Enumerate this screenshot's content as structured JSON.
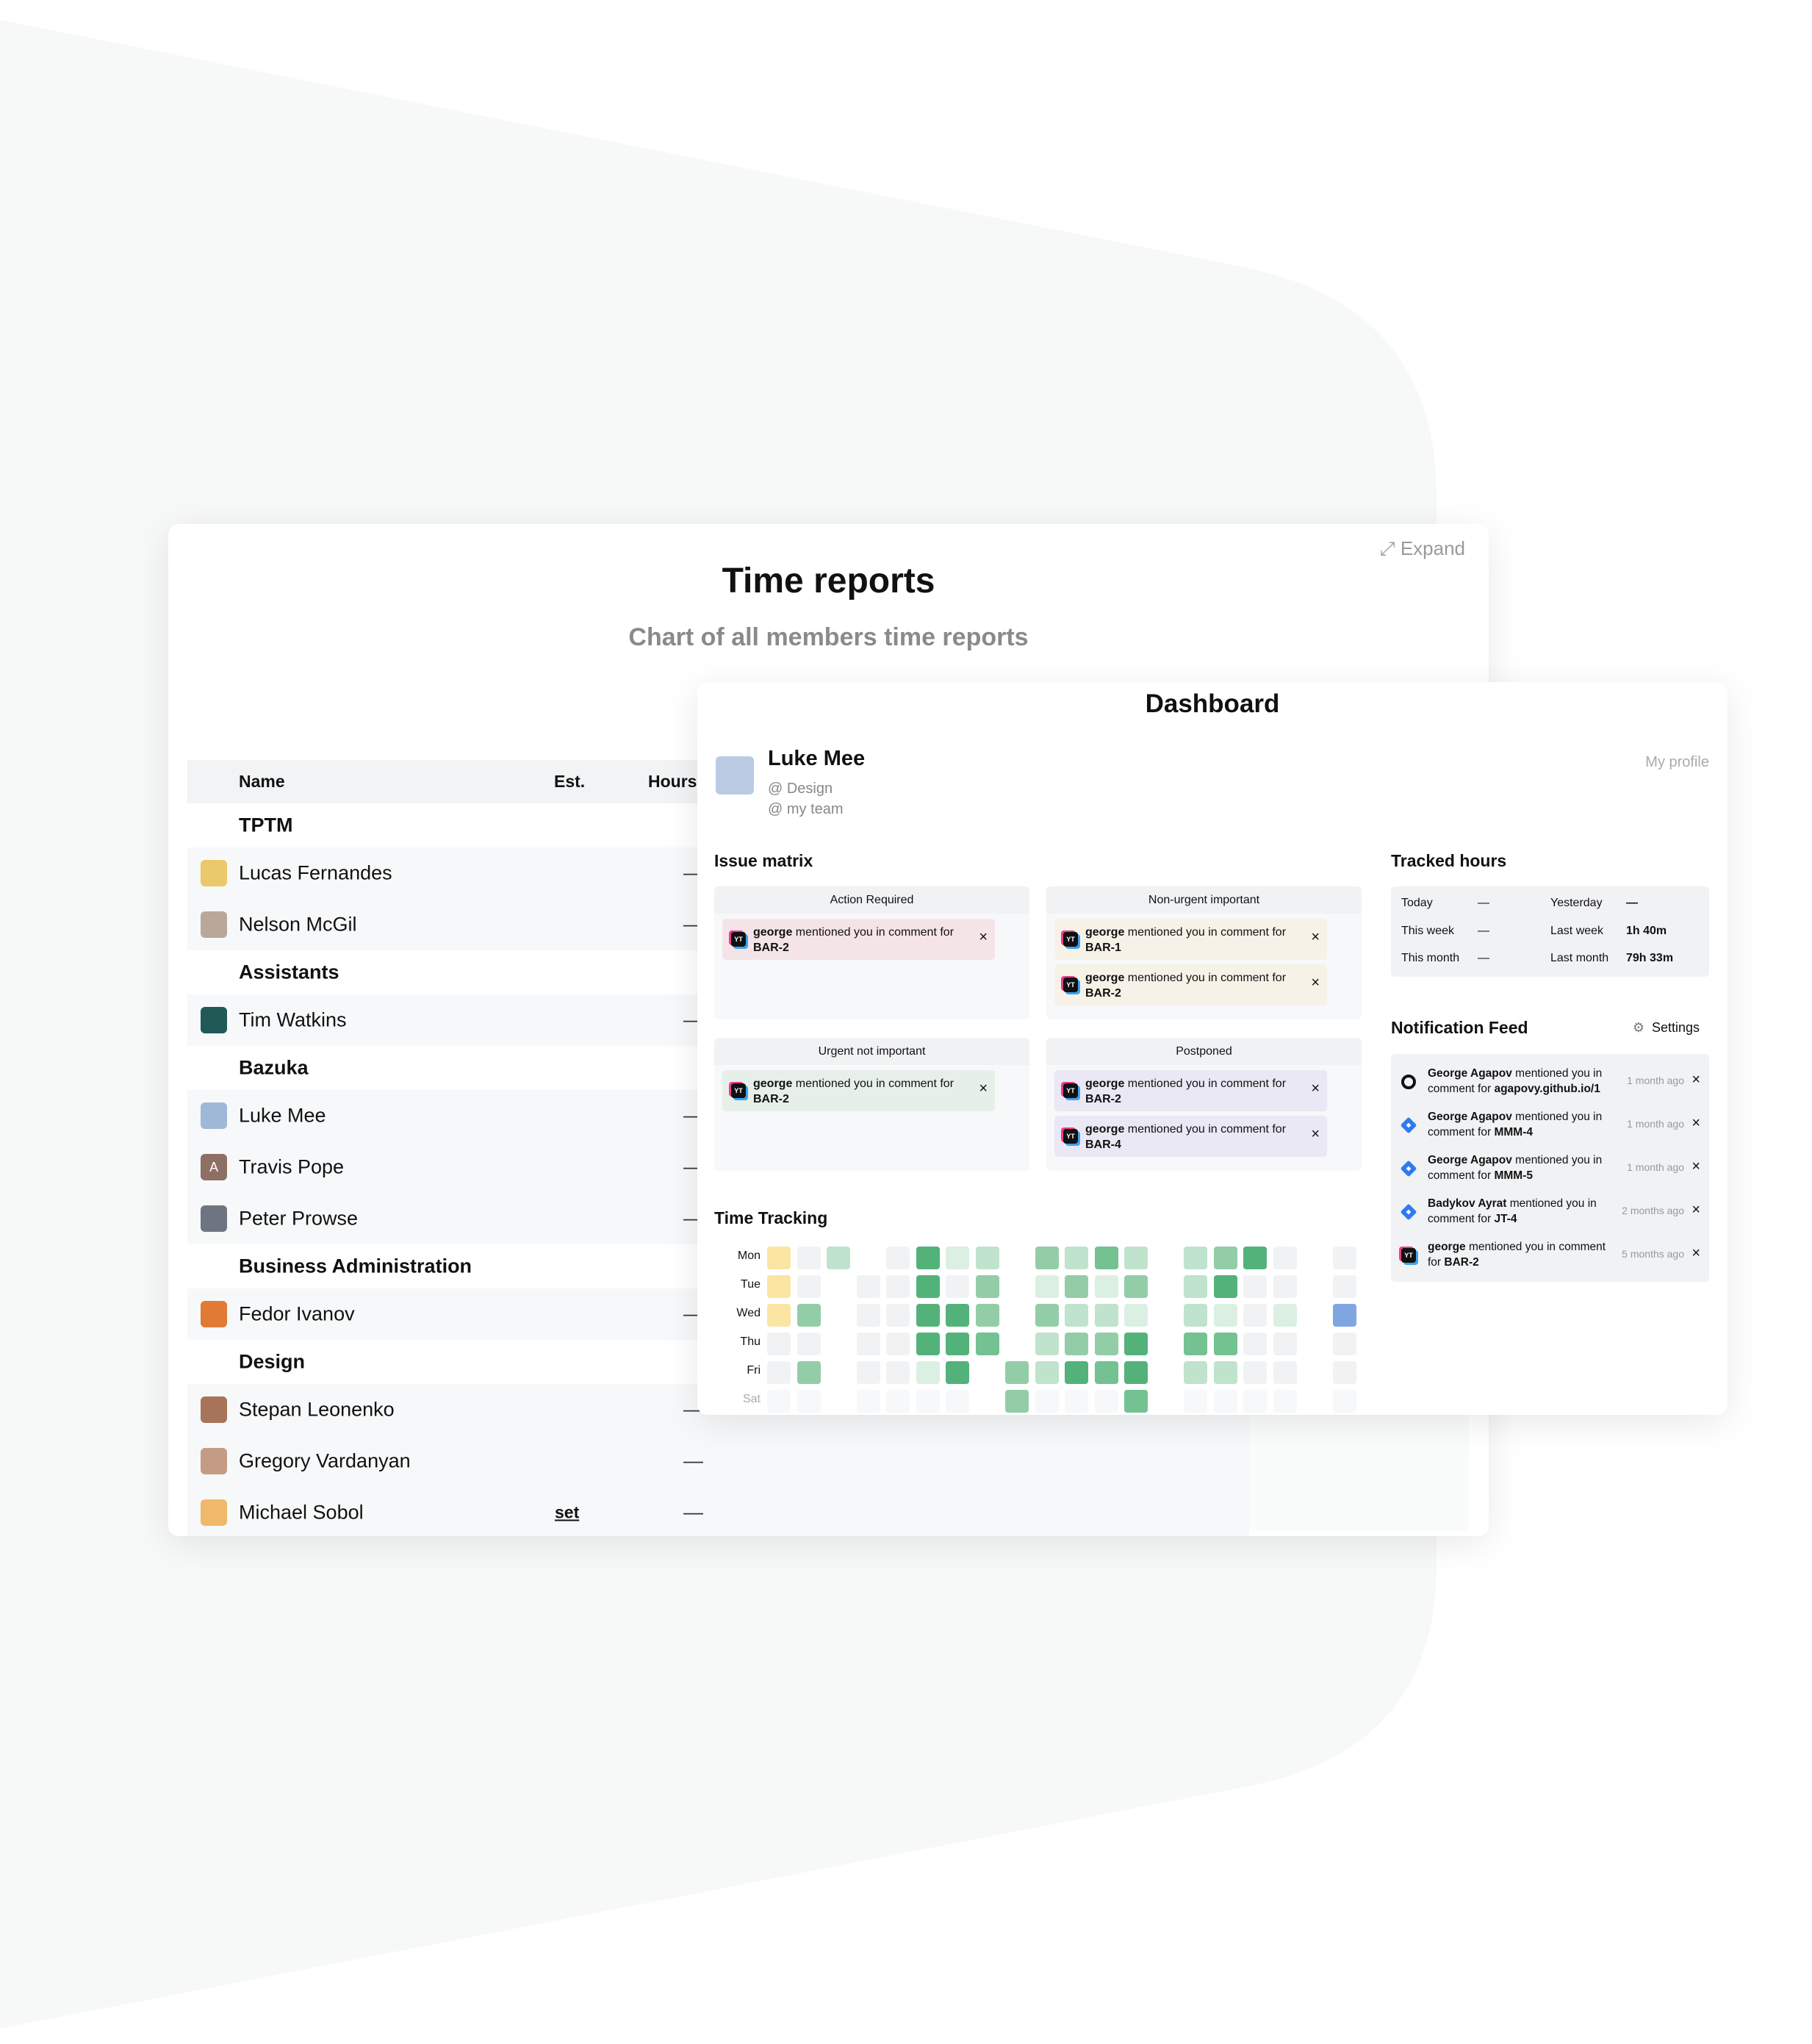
{
  "time_reports": {
    "title": "Time reports",
    "subtitle": "Chart of all members time reports",
    "expand_label": "Expand",
    "columns": {
      "name": "Name",
      "est": "Est.",
      "hours": "Hours"
    },
    "rows": [
      {
        "type": "group",
        "name": "TPTM"
      },
      {
        "type": "member",
        "name": "Lucas Fernandes",
        "hours": "—",
        "avatar_color": "#e9c96a"
      },
      {
        "type": "member",
        "name": "Nelson McGil",
        "hours": "—",
        "avatar_color": "#b9a89a"
      },
      {
        "type": "group",
        "name": "Assistants"
      },
      {
        "type": "member",
        "name": "Tim Watkins",
        "hours": "—",
        "avatar_color": "#1f5a57"
      },
      {
        "type": "group",
        "name": "Bazuka"
      },
      {
        "type": "member",
        "name": "Luke Mee",
        "hours": "—",
        "avatar_color": "#9fb8d8"
      },
      {
        "type": "member",
        "name": "Travis Pope",
        "hours": "—",
        "avatar_color": "#8e6f64",
        "initial": "A"
      },
      {
        "type": "member",
        "name": "Peter Prowse",
        "hours": "—",
        "avatar_color": "#6d7680"
      },
      {
        "type": "group",
        "name": "Business Administration"
      },
      {
        "type": "member",
        "name": "Fedor Ivanov",
        "hours": "—",
        "avatar_color": "#e07a34"
      },
      {
        "type": "group",
        "name": "Design"
      },
      {
        "type": "member",
        "name": "Stepan Leonenko",
        "hours": "—",
        "avatar_color": "#a7745a"
      },
      {
        "type": "member",
        "name": "Gregory Vardanyan",
        "hours": "—",
        "avatar_color": "#c49b84"
      },
      {
        "type": "member",
        "name": "Michael Sobol",
        "est": "set",
        "hours": "—",
        "avatar_color": "#f0b86a"
      }
    ]
  },
  "dashboard": {
    "title": "Dashboard",
    "profile": {
      "name": "Luke Mee",
      "team1": "@ Design",
      "team2": "@ my team",
      "link": "My profile"
    },
    "issue_matrix": {
      "title": "Issue matrix",
      "quadrants": [
        {
          "label": "Action Required",
          "color": "#f5e4e7",
          "items": [
            {
              "user": "george",
              "text": "mentioned you in comment for",
              "issue": "BAR-2"
            }
          ]
        },
        {
          "label": "Non-urgent important",
          "color": "#f6f2e8",
          "items": [
            {
              "user": "george",
              "text": "mentioned you in comment for",
              "issue": "BAR-1"
            },
            {
              "user": "george",
              "text": "mentioned you in comment for",
              "issue": "BAR-2"
            }
          ]
        },
        {
          "label": "Urgent not important",
          "color": "#e6f0e9",
          "items": [
            {
              "user": "george",
              "text": "mentioned you in comment for",
              "issue": "BAR-2"
            }
          ]
        },
        {
          "label": "Postponed",
          "color": "#ebe8f5",
          "items": [
            {
              "user": "george",
              "text": "mentioned you in comment for",
              "issue": "BAR-2"
            },
            {
              "user": "george",
              "text": "mentioned you in comment for",
              "issue": "BAR-4"
            }
          ]
        }
      ]
    },
    "time_tracking": {
      "title": "Time Tracking",
      "days": [
        "Mon",
        "Tue",
        "Wed",
        "Thu",
        "Fri",
        "Sat"
      ],
      "levels_legend": {
        "e": "#f1f2f4",
        "f": "#f7f8f9",
        "1": "#dcefe3",
        "2": "#bfe3cc",
        "3": "#93cda8",
        "4": "#74c191",
        "5": "#52b27a",
        "Y": "#fbe5a3",
        "B": "#7fa6e1"
      },
      "grid": [
        [
          "Y",
          "e",
          "2",
          "_",
          "e",
          "5",
          "1",
          "2",
          "_",
          "3",
          "2",
          "4",
          "2",
          "_",
          "2",
          "3",
          "5",
          "e",
          "_",
          "e"
        ],
        [
          "Y",
          "e",
          "_",
          "e",
          "e",
          "5",
          "e",
          "3",
          "_",
          "1",
          "3",
          "1",
          "3",
          "_",
          "2",
          "5",
          "e",
          "e",
          "_",
          "e"
        ],
        [
          "Y",
          "3",
          "_",
          "e",
          "e",
          "5",
          "5",
          "3",
          "_",
          "3",
          "2",
          "2",
          "1",
          "_",
          "2",
          "1",
          "e",
          "1",
          "_",
          "B"
        ],
        [
          "e",
          "e",
          "_",
          "e",
          "e",
          "5",
          "5",
          "4",
          "_",
          "2",
          "3",
          "3",
          "5",
          "_",
          "4",
          "4",
          "e",
          "e",
          "_",
          "e"
        ],
        [
          "e",
          "3",
          "_",
          "e",
          "e",
          "1",
          "5",
          "_",
          "3",
          "2",
          "5",
          "4",
          "5",
          "_",
          "2",
          "2",
          "e",
          "e",
          "_",
          "e"
        ],
        [
          "f",
          "f",
          "_",
          "f",
          "f",
          "f",
          "f",
          "_",
          "3",
          "f",
          "f",
          "f",
          "4",
          "_",
          "f",
          "f",
          "f",
          "f",
          "_",
          "f"
        ]
      ]
    },
    "tracked_hours": {
      "title": "Tracked hours",
      "rows": [
        {
          "l1": "Today",
          "v1": "—",
          "l2": "Yesterday",
          "v2": "—"
        },
        {
          "l1": "This week",
          "v1": "—",
          "l2": "Last week",
          "v2": "1h 40m"
        },
        {
          "l1": "This month",
          "v1": "—",
          "l2": "Last month",
          "v2": "79h 33m"
        }
      ]
    },
    "notifications": {
      "title": "Notification Feed",
      "settings_label": "Settings",
      "items": [
        {
          "icon": "github",
          "user": "George Agapov",
          "text": "mentioned you in comment for",
          "target": "agapovy.github.io/1",
          "time": "1 month ago"
        },
        {
          "icon": "jira",
          "user": "George Agapov",
          "text": "mentioned you in comment for",
          "target": "MMM-4",
          "time": "1 month ago"
        },
        {
          "icon": "jira",
          "user": "George Agapov",
          "text": "mentioned you in comment for",
          "target": "MMM-5",
          "time": "1 month ago"
        },
        {
          "icon": "jira",
          "user": "Badykov Ayrat",
          "text": "mentioned you in comment for",
          "target": "JT-4",
          "time": "2 months ago"
        },
        {
          "icon": "youtrack",
          "user": "george",
          "text": "mentioned you in comment for",
          "target": "BAR-2",
          "time": "5 months ago"
        }
      ]
    }
  }
}
